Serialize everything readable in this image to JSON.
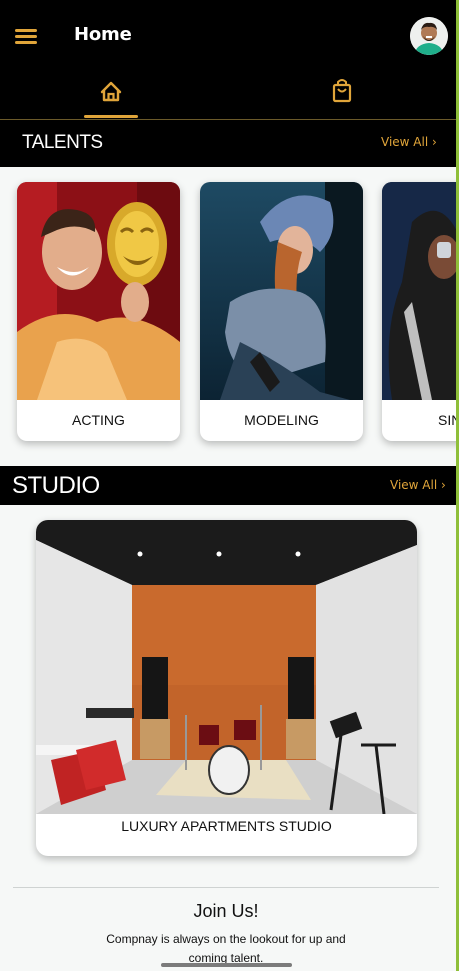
{
  "header": {
    "title": "Home",
    "tabs": [
      {
        "name": "home",
        "icon": "home-icon",
        "active": true
      },
      {
        "name": "shop",
        "icon": "shopping-bag-icon",
        "active": false
      }
    ],
    "accent_color": "#e0a53a"
  },
  "talents": {
    "heading": "TALENTS",
    "view_all": "View All ›",
    "items": [
      {
        "label": "ACTING"
      },
      {
        "label": "MODELING"
      },
      {
        "label": "SIN"
      }
    ]
  },
  "studio": {
    "heading": "STUDIO",
    "view_all": "View All ›",
    "items": [
      {
        "label": "LUXURY APARTMENTS STUDIO"
      }
    ]
  },
  "join": {
    "title": "Join Us!",
    "text": "Compnay is always on the lookout for up and coming talent."
  }
}
